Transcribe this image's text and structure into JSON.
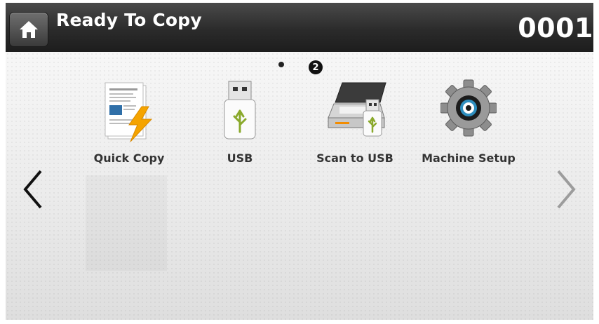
{
  "header": {
    "title": "Ready To Copy",
    "counter": "0001"
  },
  "pagination": {
    "current_page": "2"
  },
  "apps": [
    {
      "label": "Quick Copy",
      "icon": "quick-copy-icon"
    },
    {
      "label": "USB",
      "icon": "usb-icon"
    },
    {
      "label": "Scan to USB",
      "icon": "scan-to-usb-icon"
    },
    {
      "label": "Machine Setup",
      "icon": "machine-setup-icon"
    }
  ],
  "colors": {
    "header_bg": "#2b2b2b",
    "content_bg": "#e9e9e9",
    "text": "#333333",
    "lightning": "#f5a400",
    "usb_green": "#8aa92c"
  }
}
